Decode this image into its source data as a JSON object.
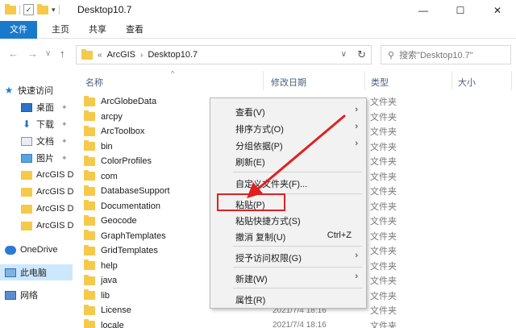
{
  "window": {
    "title": "Desktop10.7",
    "controls": {
      "minimize": "—",
      "maximize": "☐",
      "close": "✕"
    }
  },
  "ribbon": {
    "tabs": [
      "文件",
      "主页",
      "共享",
      "查看"
    ]
  },
  "address": {
    "back": "←",
    "forward": "→",
    "recent": "∨",
    "up": "↑",
    "overflow": "«",
    "crumbs": [
      "ArcGIS",
      "Desktop10.7"
    ],
    "dropdown": "∨",
    "refresh": "↻"
  },
  "search": {
    "placeholder": "搜索\"Desktop10.7\""
  },
  "navpane": {
    "items": [
      {
        "label": "快速访问",
        "icon": "star-icon",
        "pinned": false
      },
      {
        "label": "桌面",
        "icon": "desktop-icon",
        "pinned": true
      },
      {
        "label": "下载",
        "icon": "download-icon",
        "pinned": true
      },
      {
        "label": "文档",
        "icon": "document-icon",
        "pinned": true
      },
      {
        "label": "图片",
        "icon": "picture-icon",
        "pinned": true
      },
      {
        "label": "ArcGIS D",
        "icon": "folder-icon",
        "pinned": false
      },
      {
        "label": "ArcGIS D",
        "icon": "folder-icon",
        "pinned": false
      },
      {
        "label": "ArcGIS D",
        "icon": "folder-icon",
        "pinned": false
      },
      {
        "label": "ArcGIS D",
        "icon": "folder-icon",
        "pinned": false
      },
      {
        "label": "OneDrive",
        "icon": "cloud-icon",
        "pinned": false
      },
      {
        "label": "此电脑",
        "icon": "computer-icon",
        "pinned": false
      },
      {
        "label": "网络",
        "icon": "network-icon",
        "pinned": false
      }
    ]
  },
  "columns": {
    "name": "名称",
    "date": "修改日期",
    "type": "类型",
    "size": "大小"
  },
  "files": [
    {
      "name": "ArcGlobeData",
      "date": "",
      "type": "文件夹"
    },
    {
      "name": "arcpy",
      "date": "",
      "type": "文件夹"
    },
    {
      "name": "ArcToolbox",
      "date": "",
      "type": "文件夹"
    },
    {
      "name": "bin",
      "date": "",
      "type": "文件夹"
    },
    {
      "name": "ColorProfiles",
      "date": "",
      "type": "文件夹"
    },
    {
      "name": "com",
      "date": "",
      "type": "文件夹"
    },
    {
      "name": "DatabaseSupport",
      "date": "",
      "type": "文件夹"
    },
    {
      "name": "Documentation",
      "date": "",
      "type": "文件夹"
    },
    {
      "name": "Geocode",
      "date": "",
      "type": "文件夹"
    },
    {
      "name": "GraphTemplates",
      "date": "",
      "type": "文件夹"
    },
    {
      "name": "GridTemplates",
      "date": "",
      "type": "文件夹"
    },
    {
      "name": "help",
      "date": "",
      "type": "文件夹"
    },
    {
      "name": "java",
      "date": "",
      "type": "文件夹"
    },
    {
      "name": "lib",
      "date": "",
      "type": "文件夹"
    },
    {
      "name": "License",
      "date": "2021/7/4 18:16",
      "type": "文件夹"
    },
    {
      "name": "locale",
      "date": "2021/7/4 18:16",
      "type": "文件夹"
    }
  ],
  "context_menu": {
    "view": "查看(V)",
    "sort": "排序方式(O)",
    "group": "分组依据(P)",
    "refresh": "刷新(E)",
    "customize": "自定义文件夹(F)...",
    "paste": "粘贴(P)",
    "paste_shortcut": "粘贴快捷方式(S)",
    "undo": "撤消 复制(U)",
    "undo_shortcut": "Ctrl+Z",
    "grant_access": "授予访问权限(G)",
    "new": "新建(W)",
    "properties": "属性(R)"
  },
  "annotation": {
    "highlight_color": "#e02020"
  }
}
